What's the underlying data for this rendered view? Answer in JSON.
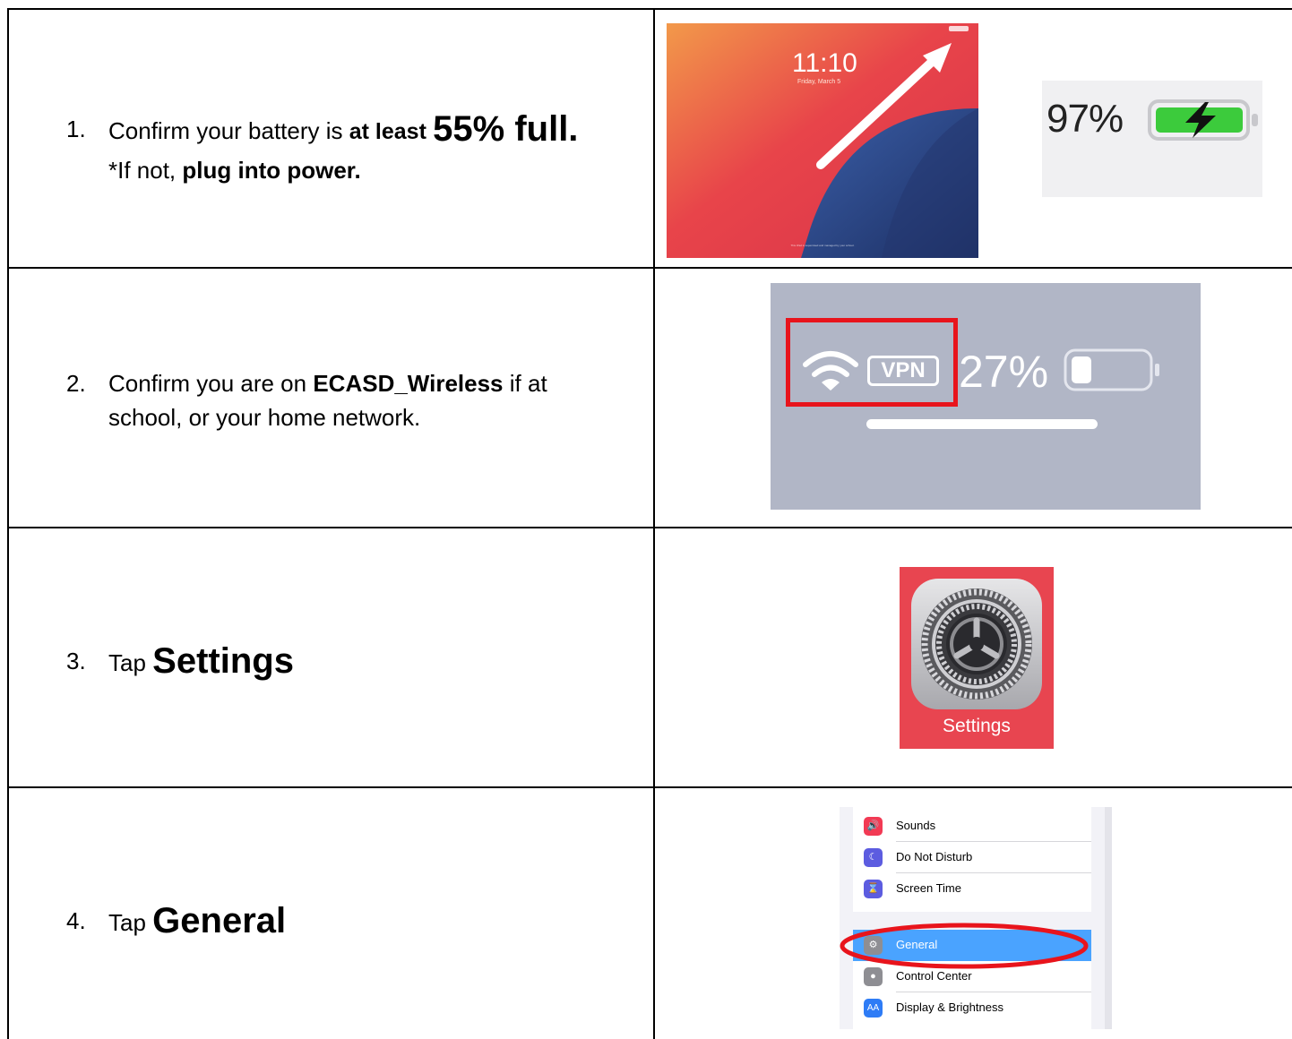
{
  "steps": [
    {
      "num": "1.",
      "line1_a": "Confirm your battery is ",
      "line1_b": "at least",
      "line1_c": "55% full.",
      "line2_a": "*If not, ",
      "line2_b": "plug into power."
    },
    {
      "num": "2.",
      "line1_a": "Confirm you are on ",
      "line1_b": "ECASD_Wireless",
      "line1_c": " if at",
      "line2": "school, or your home network."
    },
    {
      "num": "3.",
      "prefix": "Tap",
      "target": "Settings"
    },
    {
      "num": "4.",
      "prefix": "Tap",
      "target": "General"
    }
  ],
  "lockscreen": {
    "time": "11:10",
    "date": "Friday, March 5",
    "footer": "This iPad is supervised and managed by your school."
  },
  "battery_closeup": {
    "percent": "97%",
    "charging": true,
    "level": 0.97
  },
  "status_bar": {
    "vpn": "VPN",
    "percent": "27%",
    "level": 0.27,
    "highlight_color": "#e8141c"
  },
  "settings_app": {
    "label": "Settings"
  },
  "settings_list": {
    "group1": [
      {
        "label": "Sounds",
        "icon": "speaker-icon",
        "color": "#f23a54"
      },
      {
        "label": "Do Not Disturb",
        "icon": "moon-icon",
        "color": "#5c5ce0"
      },
      {
        "label": "Screen Time",
        "icon": "hourglass-icon",
        "color": "#5c5ce0"
      }
    ],
    "group2": [
      {
        "label": "General",
        "icon": "gear-icon",
        "color": "#8e8e93",
        "selected": true
      },
      {
        "label": "Control Center",
        "icon": "switches-icon",
        "color": "#8e8e93"
      },
      {
        "label": "Display & Brightness",
        "icon": "aa-icon",
        "color": "#2e7cf6"
      }
    ],
    "highlight_color": "#e8141c"
  }
}
